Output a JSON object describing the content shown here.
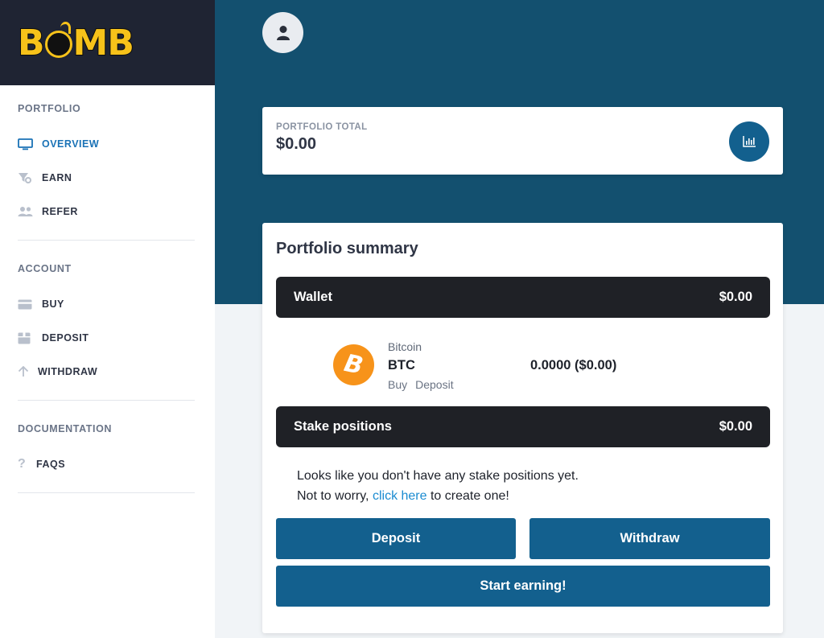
{
  "logo": {
    "text_a": "B",
    "text_b": "MB"
  },
  "sidebar": {
    "sections": [
      {
        "title": "PORTFOLIO",
        "items": [
          "OVERVIEW",
          "EARN",
          "REFER"
        ]
      },
      {
        "title": "ACCOUNT",
        "items": [
          "BUY",
          "DEPOSIT",
          "WITHDRAW"
        ]
      },
      {
        "title": "DOCUMENTATION",
        "items": [
          "FAQS"
        ]
      }
    ]
  },
  "portfolio_total": {
    "label": "PORTFOLIO TOTAL",
    "value": "$0.00"
  },
  "summary": {
    "title": "Portfolio summary",
    "wallet": {
      "label": "Wallet",
      "value": "$0.00"
    },
    "coin": {
      "name": "Bitcoin",
      "symbol": "BTC",
      "balance": "0.0000 ($0.00)",
      "link_buy": "Buy",
      "link_deposit": "Deposit"
    },
    "stake": {
      "label": "Stake positions",
      "value": "$0.00"
    },
    "empty_line1": "Looks like you don't have any stake positions yet.",
    "empty_line2_pre": "Not to worry, ",
    "empty_link": "click here",
    "empty_line2_post": " to create one!",
    "deposit_button": "Deposit",
    "withdraw_button": "Withdraw",
    "earn_button": "Start earning!"
  },
  "colors": {
    "brand": "#13506f",
    "button": "#13608e",
    "accent": "#1a72b6",
    "bitcoin": "#f7931a",
    "logo": "#f7c21a"
  }
}
